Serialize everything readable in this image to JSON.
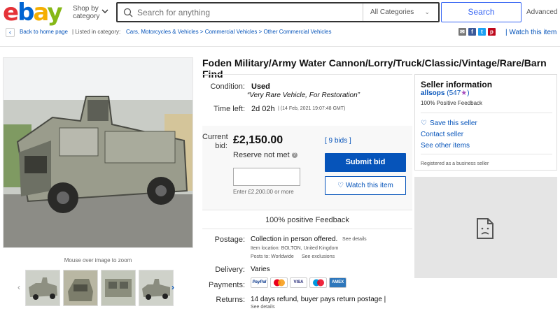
{
  "header": {
    "logo": {
      "e": "e",
      "b": "b",
      "a": "a",
      "y": "y"
    },
    "shop_by": "Shop by category",
    "search_placeholder": "Search for anything",
    "category": "All Categories",
    "search_button": "Search",
    "advanced": "Advanced"
  },
  "breadcrumb": {
    "back": "Back to home page",
    "listed": "| Listed in category:",
    "path": "Cars, Motorcycles & Vehicles > Commercial Vehicles > Other Commercial Vehicles",
    "watch": "| Watch this item"
  },
  "item": {
    "title": "Foden Military/Army Water Cannon/Lorry/Truck/Classic/Vintage/Rare/Barn Find",
    "condition_label": "Condition:",
    "condition_value": "Used",
    "condition_quote": "“Very Rare Vehicle, For Restoration”",
    "time_label": "Time left:",
    "time_value": "2d 02h",
    "time_detail": "| (14 Feb, 2021  19:07:48 GMT)",
    "bid_label_1": "Current",
    "bid_label_2": "bid:",
    "price": "£2,150.00",
    "bids": "[ 9 bids ]",
    "reserve": "Reserve not met",
    "bid_hint": "Enter £2,200.00 or more",
    "submit": "Submit bid",
    "watch": "Watch this item",
    "feedback": "100% positive Feedback",
    "postage_label": "Postage:",
    "postage_value": "Collection in person offered.",
    "postage_link": "See details",
    "location": "Item location:  BOLTON, United Kingdom",
    "posts_to": "Posts to:  Worldwide",
    "exclusions": "See exclusions",
    "delivery_label": "Delivery:",
    "delivery_value": "Varies",
    "payments_label": "Payments:",
    "returns_label": "Returns:",
    "returns_value": "14 days refund, buyer pays return postage |",
    "returns_link": "See details"
  },
  "payments": [
    {
      "name": "PayPal",
      "color": "#ffffff",
      "text": "#003087"
    },
    {
      "name": "MC",
      "color": "#ffffff",
      "text": "#eb001b"
    },
    {
      "name": "VISA",
      "color": "#ffffff",
      "text": "#1a1f71"
    },
    {
      "name": "Maestro",
      "color": "#ffffff",
      "text": "#0099df"
    },
    {
      "name": "AMEX",
      "color": "#2e77bb",
      "text": "#ffffff"
    }
  ],
  "gallery": {
    "zoom_hint": "Mouse over image to zoom"
  },
  "seller": {
    "heading": "Seller information",
    "name": "allsops",
    "score": "(547",
    "score_end": ")",
    "feedback": "100% Positive Feedback",
    "save": "Save this seller",
    "contact": "Contact seller",
    "other": "See other items",
    "business": "Registered as a business seller"
  },
  "share_icons": [
    "mail-icon",
    "facebook-icon",
    "twitter-icon",
    "pinterest-icon"
  ]
}
